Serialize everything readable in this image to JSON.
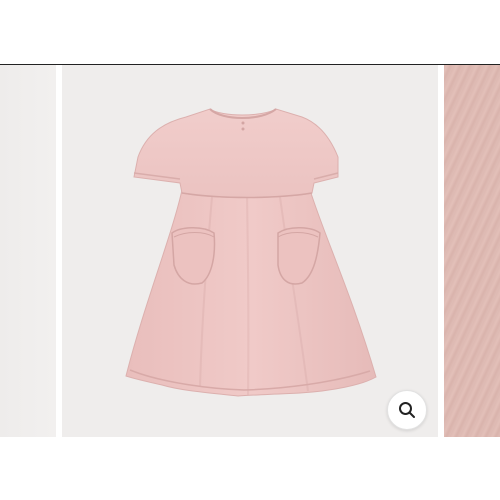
{
  "product_gallery": {
    "images": [
      {
        "name": "previous-product-image"
      },
      {
        "name": "pink-short-sleeve-dress-image"
      },
      {
        "name": "fabric-texture-closeup-image"
      }
    ],
    "zoom": {
      "icon": "magnifier-icon"
    }
  },
  "colors": {
    "dress_pink": "#eec7c5",
    "background": "#efedec",
    "fabric_texture": "#ddb9b2"
  }
}
